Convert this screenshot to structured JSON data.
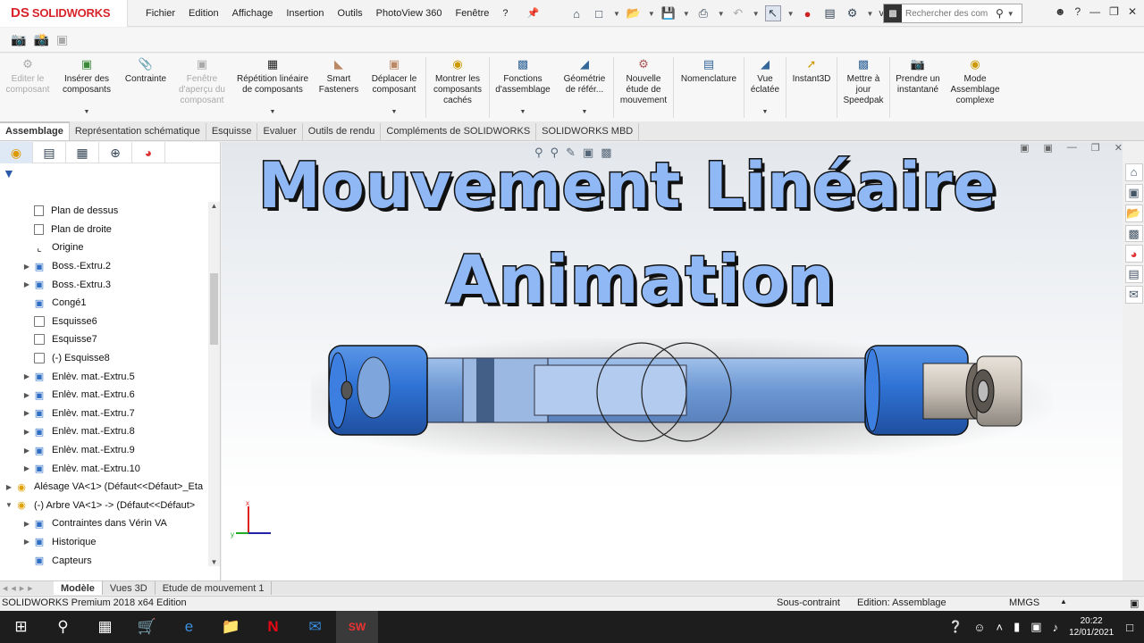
{
  "app": {
    "logo_mark": "DS",
    "logo_text": "SOLIDWORKS"
  },
  "menu": [
    "Fichier",
    "Edition",
    "Affichage",
    "Insertion",
    "Outils",
    "PhotoView 360",
    "Fenêtre",
    "?"
  ],
  "search": {
    "placeholder": "Rechercher des com"
  },
  "toolbar_more": "v...",
  "ribbon": [
    {
      "label": "Editer le composant",
      "icon": "edit-component-icon",
      "disabled": true
    },
    {
      "label": "Insérer des composants",
      "icon": "insert-components-icon",
      "disabled": false,
      "dropdown": true
    },
    {
      "label": "Contrainte",
      "icon": "mate-icon",
      "disabled": false
    },
    {
      "label": "Fenêtre d'aperçu du composant",
      "icon": "preview-window-icon",
      "disabled": true
    },
    {
      "label": "Répétition linéaire de composants",
      "icon": "linear-pattern-icon",
      "disabled": false,
      "dropdown": true
    },
    {
      "label": "Smart Fasteners",
      "icon": "smart-fasteners-icon",
      "disabled": false
    },
    {
      "label": "Déplacer le composant",
      "icon": "move-component-icon",
      "disabled": false,
      "dropdown": true
    },
    {
      "label": "Montrer les composants cachés",
      "icon": "show-hidden-icon",
      "disabled": false
    },
    {
      "label": "Fonctions d'assemblage",
      "icon": "assembly-features-icon",
      "disabled": false,
      "dropdown": true
    },
    {
      "label": "Géométrie de référ...",
      "icon": "reference-geometry-icon",
      "disabled": false,
      "dropdown": true
    },
    {
      "label": "Nouvelle étude de mouvement",
      "icon": "motion-study-icon",
      "disabled": false
    },
    {
      "label": "Nomenclature",
      "icon": "bom-icon",
      "disabled": false
    },
    {
      "label": "Vue éclatée",
      "icon": "exploded-view-icon",
      "disabled": false,
      "dropdown": true
    },
    {
      "label": "Instant3D",
      "icon": "instant3d-icon",
      "disabled": false
    },
    {
      "label": "Mettre à jour Speedpak",
      "icon": "speedpak-icon",
      "disabled": false
    },
    {
      "label": "Prendre un instantané",
      "icon": "snapshot-icon",
      "disabled": false
    },
    {
      "label": "Mode Assemblage complexe",
      "icon": "large-assembly-icon",
      "disabled": false
    }
  ],
  "tabs": [
    "Assemblage",
    "Représentation schématique",
    "Esquisse",
    "Evaluer",
    "Outils de rendu",
    "Compléments de SOLIDWORKS",
    "SOLIDWORKS MBD"
  ],
  "tree": [
    {
      "label": "Plan de dessus",
      "type": "plane",
      "expand": false,
      "indent": 1
    },
    {
      "label": "Plan de droite",
      "type": "plane",
      "expand": false,
      "indent": 1
    },
    {
      "label": "Origine",
      "type": "origin",
      "expand": false,
      "indent": 1
    },
    {
      "label": "Boss.-Extru.2",
      "type": "feat",
      "expand": true,
      "indent": 1
    },
    {
      "label": "Boss.-Extru.3",
      "type": "feat",
      "expand": true,
      "indent": 1
    },
    {
      "label": "Congé1",
      "type": "feat",
      "expand": false,
      "indent": 1
    },
    {
      "label": "Esquisse6",
      "type": "sketch",
      "expand": false,
      "indent": 1
    },
    {
      "label": "Esquisse7",
      "type": "sketch",
      "expand": false,
      "indent": 1
    },
    {
      "label": "(-) Esquisse8",
      "type": "sketch",
      "expand": false,
      "indent": 1
    },
    {
      "label": "Enlèv. mat.-Extru.5",
      "type": "feat",
      "expand": true,
      "indent": 1
    },
    {
      "label": "Enlèv. mat.-Extru.6",
      "type": "feat",
      "expand": true,
      "indent": 1
    },
    {
      "label": "Enlèv. mat.-Extru.7",
      "type": "feat",
      "expand": true,
      "indent": 1
    },
    {
      "label": "Enlèv. mat.-Extru.8",
      "type": "feat",
      "expand": true,
      "indent": 1
    },
    {
      "label": "Enlèv. mat.-Extru.9",
      "type": "feat",
      "expand": true,
      "indent": 1
    },
    {
      "label": "Enlèv. mat.-Extru.10",
      "type": "feat",
      "expand": true,
      "indent": 1
    },
    {
      "label": "Alésage VA<1> (Défaut<<Défaut>_Eta",
      "type": "asm",
      "expand": true,
      "indent": 0
    },
    {
      "label": "(-) Arbre VA<1> -> (Défaut<<Défaut>",
      "type": "asm",
      "expand": "open",
      "indent": 0
    },
    {
      "label": "Contraintes dans Vérin VA",
      "type": "feat",
      "expand": true,
      "indent": 1
    },
    {
      "label": "Historique",
      "type": "feat",
      "expand": true,
      "indent": 1
    },
    {
      "label": "Capteurs",
      "type": "feat",
      "expand": false,
      "indent": 1
    }
  ],
  "overlay": {
    "line1": "Mouvement Linéaire",
    "line2": "Animation"
  },
  "bottom_tabs": [
    "Modèle",
    "Vues 3D",
    "Etude de mouvement 1"
  ],
  "status": {
    "edition": "SOLIDWORKS Premium 2018 x64 Edition",
    "constraint": "Sous-contraint",
    "mode": "Edition: Assemblage",
    "units": "MMGS"
  },
  "clock": {
    "time": "20:22",
    "date": "12/01/2021"
  },
  "colors": {
    "title_fill": "#8fb8f5",
    "cylinder_blue": "#2f73d6",
    "logo_red": "#d8232a"
  }
}
